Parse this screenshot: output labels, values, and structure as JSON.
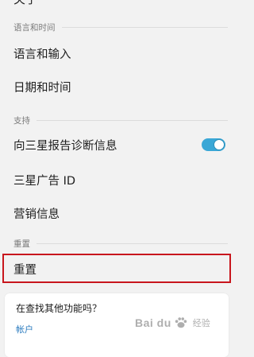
{
  "top_item": {
    "label": "关于"
  },
  "sections": [
    {
      "header": "语言和时间",
      "items": [
        "语言和输入",
        "日期和时间"
      ]
    },
    {
      "header": "支持",
      "items": [
        "向三星报告诊断信息",
        "三星广告 ID",
        "营销信息"
      ]
    },
    {
      "header": "重置",
      "items": [
        "重置"
      ]
    }
  ],
  "diagnostics_toggle": {
    "state": "on",
    "color": "#3aa7d6"
  },
  "help_card": {
    "title": "在查找其他功能吗？",
    "link": "帐户"
  },
  "watermark": {
    "brand": "Bai du",
    "suffix": "经验"
  },
  "colors": {
    "highlight": "#c8161d",
    "link": "#2a7bbf"
  }
}
